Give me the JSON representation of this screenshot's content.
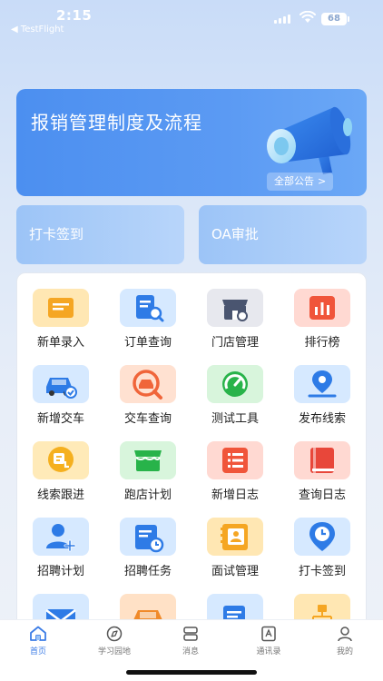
{
  "status_bar": {
    "time": "2:15",
    "back_app": "◀ TestFlight",
    "battery": "68"
  },
  "banner": {
    "title": "报销管理制度及流程",
    "all_notice_label": "全部公告",
    "chevron": ">"
  },
  "quick_actions": [
    {
      "label": "打卡签到"
    },
    {
      "label": "OA审批"
    }
  ],
  "grid_items": [
    {
      "label": "新单录入",
      "icon": "document-list-icon",
      "bg": "#ffe7b3",
      "fg": "#f5a623"
    },
    {
      "label": "订单查询",
      "icon": "document-search-icon",
      "bg": "#d6e9ff",
      "fg": "#2e7be6"
    },
    {
      "label": "门店管理",
      "icon": "store-icon",
      "bg": "#e7e8ee",
      "fg": "#4a5570"
    },
    {
      "label": "排行榜",
      "icon": "bar-chart-icon",
      "bg": "#ffd9d2",
      "fg": "#f0553a"
    },
    {
      "label": "新增交车",
      "icon": "car-check-icon",
      "bg": "#d6e9ff",
      "fg": "#2e7be6"
    },
    {
      "label": "交车查询",
      "icon": "car-search-icon",
      "bg": "#ffe1d1",
      "fg": "#f0653a"
    },
    {
      "label": "测试工具",
      "icon": "speedometer-icon",
      "bg": "#d8f5dc",
      "fg": "#28b34a"
    },
    {
      "label": "发布线索",
      "icon": "location-pin-icon",
      "bg": "#d6e9ff",
      "fg": "#2e7be6"
    },
    {
      "label": "线索跟进",
      "icon": "follow-up-icon",
      "bg": "#ffeab8",
      "fg": "#f5b01f"
    },
    {
      "label": "跑店计划",
      "icon": "storefront-plan-icon",
      "bg": "#d8f5dc",
      "fg": "#28b34a"
    },
    {
      "label": "新增日志",
      "icon": "list-add-icon",
      "bg": "#ffd9d2",
      "fg": "#f0553a"
    },
    {
      "label": "查询日志",
      "icon": "book-icon",
      "bg": "#ffd9d2",
      "fg": "#e8473a"
    },
    {
      "label": "招聘计划",
      "icon": "user-add-icon",
      "bg": "#d6e9ff",
      "fg": "#2e7be6"
    },
    {
      "label": "招聘任务",
      "icon": "calendar-task-icon",
      "bg": "#d6e9ff",
      "fg": "#2e7be6"
    },
    {
      "label": "面试管理",
      "icon": "contact-card-icon",
      "bg": "#ffe7b3",
      "fg": "#f5a623"
    },
    {
      "label": "打卡签到",
      "icon": "clock-pin-icon",
      "bg": "#d6e9ff",
      "fg": "#2e7be6"
    },
    {
      "label": "",
      "icon": "mail-icon",
      "bg": "#d6e9ff",
      "fg": "#2e7be6"
    },
    {
      "label": "",
      "icon": "car-icon",
      "bg": "#ffe1c6",
      "fg": "#f08a2a"
    },
    {
      "label": "",
      "icon": "document-edit-icon",
      "bg": "#d6e9ff",
      "fg": "#2e7be6"
    },
    {
      "label": "",
      "icon": "org-chart-icon",
      "bg": "#ffe7b3",
      "fg": "#f5a623"
    }
  ],
  "tabs": [
    {
      "label": "首页",
      "icon": "home-icon",
      "active": true
    },
    {
      "label": "学习园地",
      "icon": "compass-icon",
      "active": false
    },
    {
      "label": "消息",
      "icon": "message-icon",
      "active": false
    },
    {
      "label": "通讯录",
      "icon": "contacts-icon",
      "active": false
    },
    {
      "label": "我的",
      "icon": "profile-icon",
      "active": false
    }
  ]
}
